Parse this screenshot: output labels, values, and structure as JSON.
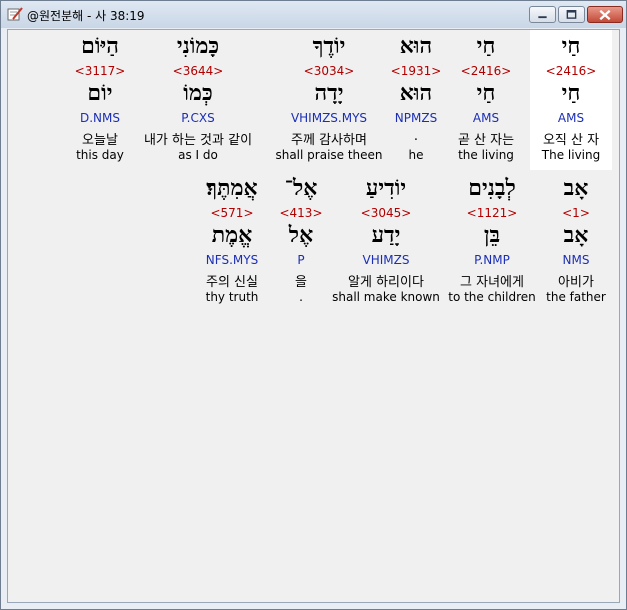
{
  "window": {
    "title": "@원전분해 - 사 38:19"
  },
  "icons": {
    "app": "book-pen-icon",
    "minimize": "minimize-icon",
    "maximize": "maximize-icon",
    "close": "close-icon"
  },
  "rows": [
    {
      "words": [
        {
          "heb": "הַיּוֹם",
          "strong": "<3117>",
          "lex": "יוֹם",
          "morph": "D.NMS",
          "kor": "오늘날",
          "eng": "this day"
        },
        {
          "heb": "כָּמוֹנִי",
          "strong": "<3644>",
          "lex": "כְּמוֹ",
          "morph": "P.CXS",
          "kor": "내가 하는 것과 같이",
          "eng": "as I do"
        },
        {
          "heb": "יוֹדֶךָ",
          "strong": "<3034>",
          "lex": "יָדָה",
          "morph": "VHIMZS.MYS",
          "kor": "주께 감사하며",
          "eng": "shall praise theen"
        },
        {
          "heb": "הוּא",
          "strong": "<1931>",
          "lex": "הוּא",
          "morph": "NPMZS",
          "kor": ".",
          "eng": "he"
        },
        {
          "heb": "חַי",
          "strong": "<2416>",
          "lex": "חַי",
          "morph": "AMS",
          "kor": "곧 산 자는",
          "eng": "the living"
        },
        {
          "heb": "חַי",
          "strong": "<2416>",
          "lex": "חַי",
          "morph": "AMS",
          "kor": "오직 산 자",
          "eng": "The living"
        }
      ]
    },
    {
      "words": [
        {
          "heb": "אֲמִתֶּךָ׃",
          "strong": "<571>",
          "lex": "אֱמֶת",
          "morph": "NFS.MYS",
          "kor": "주의 신실",
          "eng": "thy truth"
        },
        {
          "heb": "אֶל־",
          "strong": "<413>",
          "lex": "אֶל",
          "morph": "P",
          "kor": "을",
          "eng": "."
        },
        {
          "heb": "יוֹדִיעַ",
          "strong": "<3045>",
          "lex": "יָדַע",
          "morph": "VHIMZS",
          "kor": "알게 하리이다",
          "eng": "shall make known"
        },
        {
          "heb": "לְבָנִים",
          "strong": "<1121>",
          "lex": "בֵּן",
          "morph": "P.NMP",
          "kor": "그 자녀에게",
          "eng": "to the children"
        },
        {
          "heb": "אָב",
          "strong": "<1>",
          "lex": "אָב",
          "morph": "NMS",
          "kor": "아비가",
          "eng": "the father"
        }
      ]
    }
  ]
}
